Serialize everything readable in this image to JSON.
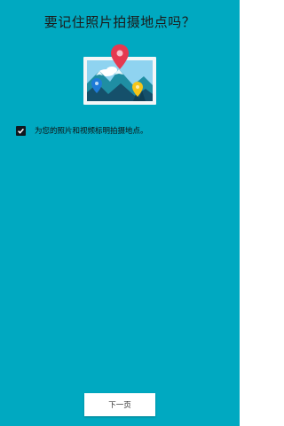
{
  "colors": {
    "background": "#00A9C1",
    "checkbox_fill": "#101820",
    "button_background": "#FFFFFF",
    "pin_red": "#E53950",
    "pin_blue": "#1E7BD8",
    "pin_yellow": "#F5C518"
  },
  "title": "要记住照片拍摄地点吗？",
  "illustration": {
    "icon": "photo-with-location-pins-icon"
  },
  "location_option": {
    "checked": true,
    "label": "为您的照片和视频标明拍摄地点。"
  },
  "next_button": {
    "label": "下一页"
  }
}
